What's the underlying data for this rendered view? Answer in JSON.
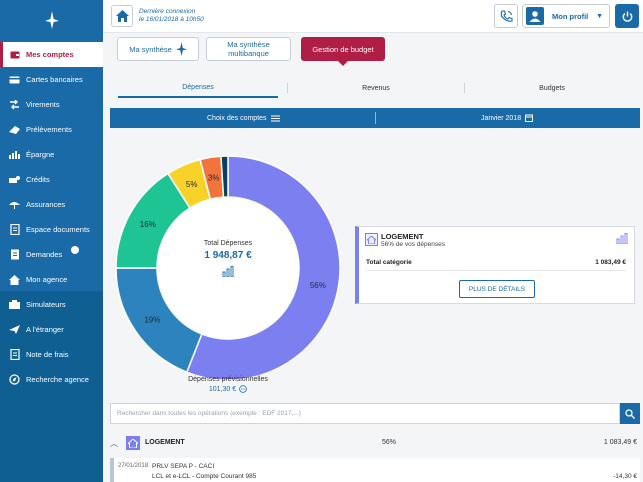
{
  "header": {
    "last_connection_line1": "Dernière connexion",
    "last_connection_line2": "le 16/01/2018 à 10h50",
    "profile_label": "Mon profil"
  },
  "sidebar": {
    "items": [
      {
        "label": "Mes comptes",
        "icon": "wallet-icon"
      },
      {
        "label": "Cartes bancaires",
        "icon": "card-icon"
      },
      {
        "label": "Virements",
        "icon": "transfer-icon"
      },
      {
        "label": "Prélèvements",
        "icon": "debit-icon"
      },
      {
        "label": "Épargne",
        "icon": "savings-icon"
      },
      {
        "label": "Crédits",
        "icon": "credit-icon"
      },
      {
        "label": "Assurances",
        "icon": "insurance-icon"
      },
      {
        "label": "Espace documents",
        "icon": "documents-icon"
      },
      {
        "label": "Demandes",
        "icon": "requests-icon"
      },
      {
        "label": "Mon agence",
        "icon": "agency-icon"
      }
    ],
    "lower_items": [
      {
        "label": "Simulateurs",
        "icon": "calculator-icon"
      },
      {
        "label": "A l'étranger",
        "icon": "plane-icon"
      },
      {
        "label": "Note de frais",
        "icon": "receipt-icon"
      },
      {
        "label": "Recherche agence",
        "icon": "search-agency-icon"
      }
    ]
  },
  "top_tabs": {
    "tab1": "Ma synthèse",
    "tab2_line1": "Ma synthèse",
    "tab2_line2": "multibanque",
    "tab3": "Gestion de budget"
  },
  "sub_tabs": {
    "depenses": "Dépenses",
    "revenus": "Revenus",
    "budgets": "Budgets"
  },
  "filter": {
    "accounts": "Choix des comptes",
    "period": "Janvier 2018"
  },
  "chart_data": {
    "type": "pie",
    "center_title": "Total Dépenses",
    "center_value": "1 948,87 €",
    "slices": [
      {
        "label": "56%",
        "value": 56,
        "color": "#7b7ff0"
      },
      {
        "label": "19%",
        "value": 19,
        "color": "#2d83bd"
      },
      {
        "label": "16%",
        "value": 16,
        "color": "#1fc495"
      },
      {
        "label": "5%",
        "value": 5,
        "color": "#f7d32a"
      },
      {
        "label": "3%",
        "value": 3,
        "color": "#f2743c"
      },
      {
        "label": "",
        "value": 1,
        "color": "#0d3f5c"
      }
    ]
  },
  "forecast": {
    "label": "Dépenses prévisionnelles",
    "value": "101,30 €"
  },
  "detail": {
    "title": "LOGEMENT",
    "subtitle": "56% de vos dépenses",
    "total_label": "Total catégorie",
    "total_value": "1 083,49 €",
    "button": "PLUS DE DÉTAILS"
  },
  "search": {
    "placeholder": "Rechercher dans toutes les opérations (exemple : EDF 2017,...)"
  },
  "category_row": {
    "name": "LOGEMENT",
    "percent": "56%",
    "amount": "1 083,49 €"
  },
  "operation": {
    "date": "27/01/2018",
    "label": "PRLV SEPA P - CACI",
    "account": "LCL et e-LCL - Compte Courant 985",
    "amount": "-14,30 €"
  },
  "colors": {
    "brand_blue": "#1b6aa8",
    "accent_red": "#b01d45",
    "logement_purple": "#7b7ff0"
  }
}
